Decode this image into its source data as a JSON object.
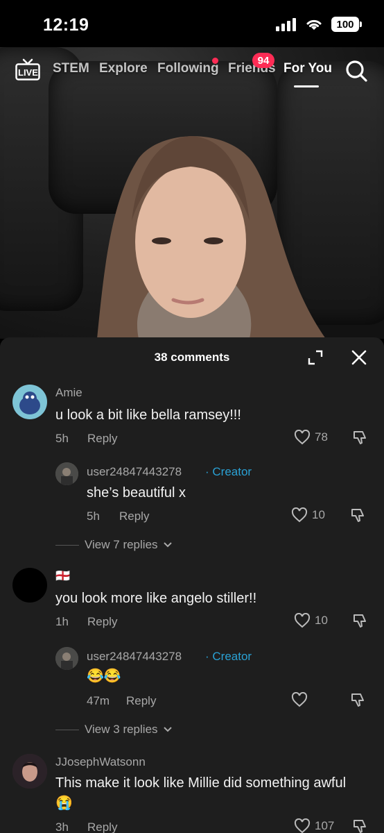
{
  "status": {
    "time": "12:19",
    "battery": "100"
  },
  "nav": {
    "live": "LIVE",
    "items": [
      "STEM",
      "Explore",
      "Following",
      "Friends",
      "For You"
    ],
    "friends_badge": "94"
  },
  "comments_panel": {
    "count_label": "38 comments",
    "comments": [
      {
        "user": "Amie",
        "text": "u look a bit like bella ramsey!!!",
        "time": "5h",
        "reply": "Reply",
        "likes": "78"
      },
      {
        "user": "user24847443278",
        "creator_tag": "· Creator",
        "text": "she’s beautiful x",
        "time": "5h",
        "reply": "Reply",
        "likes": "10"
      },
      {
        "view_replies": "View 7 replies"
      },
      {
        "user": "🏴󠁧󠁢󠁥󠁮󠁧󠁿",
        "text": "you look more like angelo stiller!!",
        "time": "1h",
        "reply": "Reply",
        "likes": "10"
      },
      {
        "user": "user24847443278",
        "creator_tag": "· Creator",
        "text": "😂😂",
        "time": "47m",
        "reply": "Reply",
        "likes": ""
      },
      {
        "view_replies": "View 3 replies"
      },
      {
        "user": "JJosephWatsonn",
        "text": "This make it look like Millie did something awful 😭",
        "time": "3h",
        "reply": "Reply",
        "likes": "107"
      }
    ]
  },
  "colors": {
    "accent": "#fe2c55",
    "creator": "#2aa1d4",
    "panel": "#1e1e1e"
  },
  "icons": [
    "signal-icon",
    "wifi-icon",
    "battery-icon",
    "live-tv-icon",
    "search-icon",
    "expand-icon",
    "close-icon",
    "heart-icon",
    "dislike-icon",
    "chevron-down-icon"
  ]
}
